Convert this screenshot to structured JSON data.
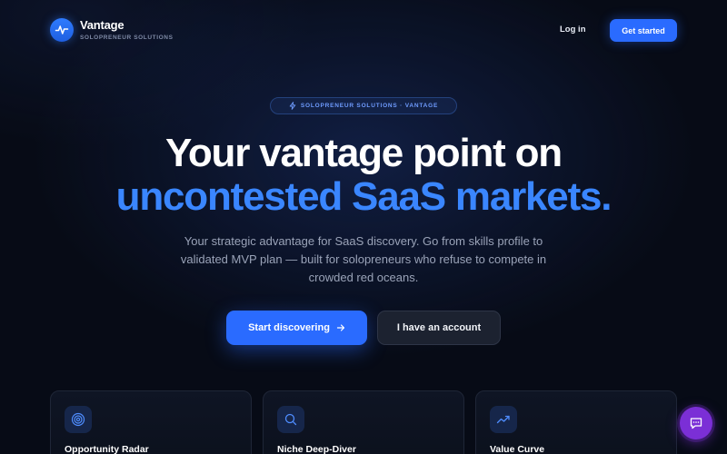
{
  "brand": {
    "name": "Vantage",
    "tagline": "SOLOPRENEUR SOLUTIONS",
    "logo_icon": "pulse-icon"
  },
  "nav": {
    "login_label": "Log in",
    "get_started_label": "Get started"
  },
  "hero": {
    "pill_text": "SOLOPRENEUR SOLUTIONS · VANTAGE",
    "pill_icon": "bolt-icon",
    "headline_line1": "Your vantage point on",
    "headline_line2": "uncontested SaaS markets.",
    "subtitle": "Your strategic advantage for SaaS discovery. Go from skills profile to validated MVP plan — built for solopreneurs who refuse to compete in crowded red oceans.",
    "primary_cta": "Start discovering",
    "secondary_cta": "I have an account"
  },
  "features": [
    {
      "title": "Opportunity Radar",
      "icon": "radar-icon"
    },
    {
      "title": "Niche Deep-Diver",
      "icon": "search-icon"
    },
    {
      "title": "Value Curve",
      "icon": "trending-up-icon"
    }
  ],
  "colors": {
    "background": "#070b16",
    "accent": "#2a6bff",
    "headline_accent": "#3a86ff",
    "chat_button": "#7b2fd6"
  }
}
